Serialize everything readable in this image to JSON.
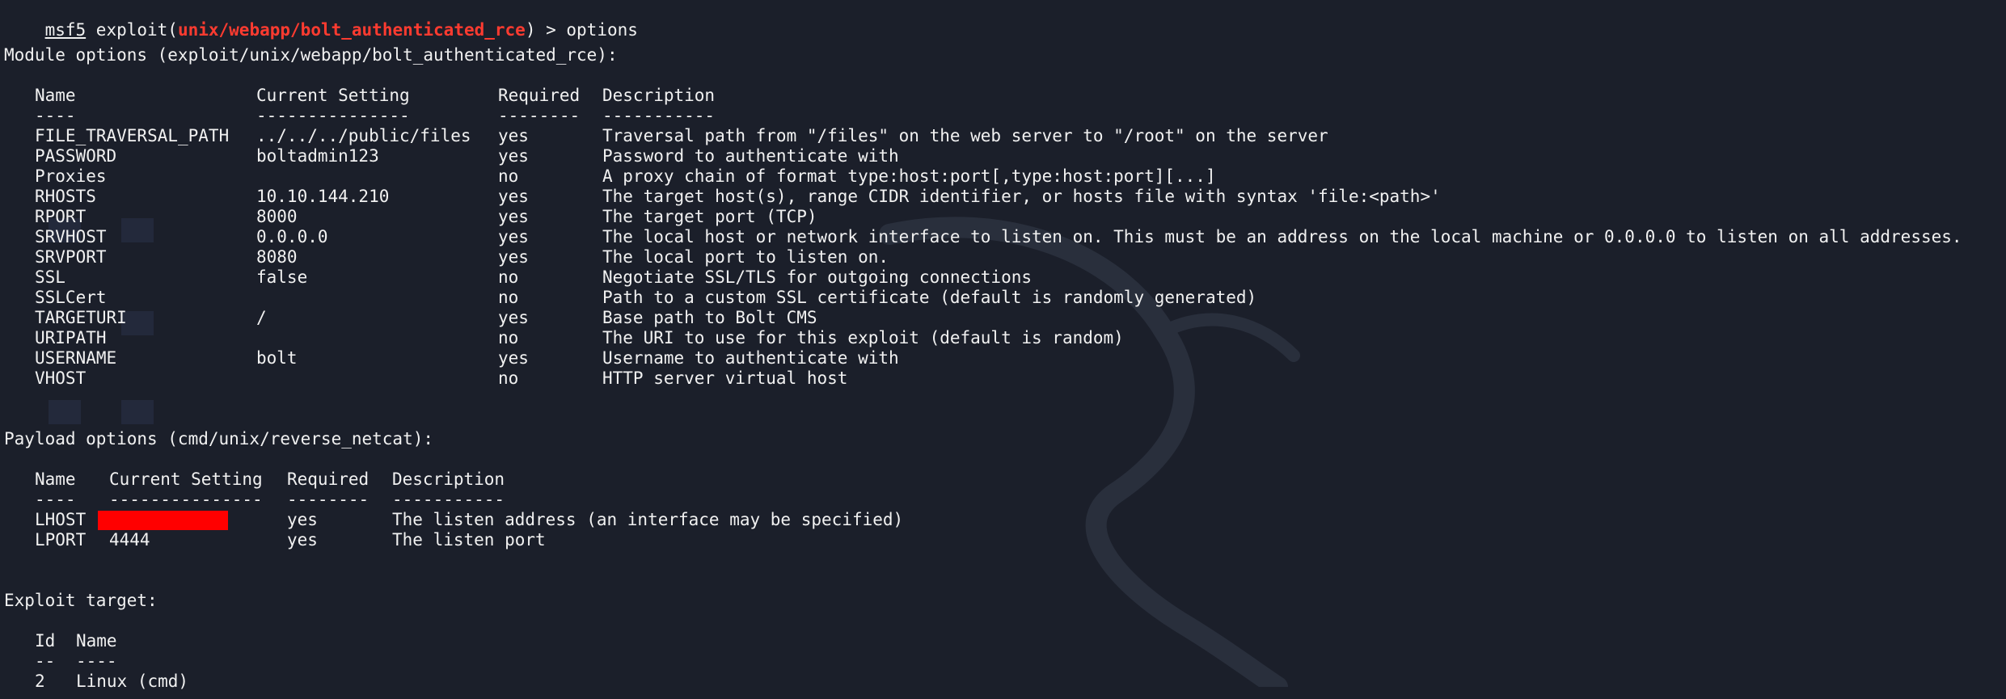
{
  "prompt": {
    "msf": "msf5",
    "exploit_prefix": " exploit(",
    "module_path": "unix/webapp/bolt_authenticated_rce",
    "suffix_and_command": ") > options"
  },
  "module": {
    "header": "Module options (exploit/unix/webapp/bolt_authenticated_rce):",
    "columns": [
      "Name",
      "Current Setting",
      "Required",
      "Description"
    ],
    "separators": [
      "----",
      "---------------",
      "--------",
      "-----------"
    ],
    "rows": [
      {
        "name": "FILE_TRAVERSAL_PATH",
        "setting": "../../../public/files",
        "required": "yes",
        "description": "Traversal path from \"/files\" on the web server to \"/root\" on the server"
      },
      {
        "name": "PASSWORD",
        "setting": "boltadmin123",
        "required": "yes",
        "description": "Password to authenticate with"
      },
      {
        "name": "Proxies",
        "setting": "",
        "required": "no",
        "description": "A proxy chain of format type:host:port[,type:host:port][...]"
      },
      {
        "name": "RHOSTS",
        "setting": "10.10.144.210",
        "required": "yes",
        "description": "The target host(s), range CIDR identifier, or hosts file with syntax 'file:<path>'"
      },
      {
        "name": "RPORT",
        "setting": "8000",
        "required": "yes",
        "description": "The target port (TCP)"
      },
      {
        "name": "SRVHOST",
        "setting": "0.0.0.0",
        "required": "yes",
        "description": "The local host or network interface to listen on. This must be an address on the local machine or 0.0.0.0 to listen on all addresses."
      },
      {
        "name": "SRVPORT",
        "setting": "8080",
        "required": "yes",
        "description": "The local port to listen on."
      },
      {
        "name": "SSL",
        "setting": "false",
        "required": "no",
        "description": "Negotiate SSL/TLS for outgoing connections"
      },
      {
        "name": "SSLCert",
        "setting": "",
        "required": "no",
        "description": "Path to a custom SSL certificate (default is randomly generated)"
      },
      {
        "name": "TARGETURI",
        "setting": "/",
        "required": "yes",
        "description": "Base path to Bolt CMS"
      },
      {
        "name": "URIPATH",
        "setting": "",
        "required": "no",
        "description": "The URI to use for this exploit (default is random)"
      },
      {
        "name": "USERNAME",
        "setting": "bolt",
        "required": "yes",
        "description": "Username to authenticate with"
      },
      {
        "name": "VHOST",
        "setting": "",
        "required": "no",
        "description": "HTTP server virtual host"
      }
    ]
  },
  "payload": {
    "header": "Payload options (cmd/unix/reverse_netcat):",
    "columns": [
      "Name",
      "Current Setting",
      "Required",
      "Description"
    ],
    "separators": [
      "----",
      "---------------",
      "--------",
      "-----------"
    ],
    "rows": [
      {
        "name": "LHOST",
        "setting": "",
        "redacted": true,
        "required": "yes",
        "description": "The listen address (an interface may be specified)"
      },
      {
        "name": "LPORT",
        "setting": "4444",
        "required": "yes",
        "description": "The listen port"
      }
    ]
  },
  "target": {
    "header": "Exploit target:",
    "columns": [
      "Id",
      "Name"
    ],
    "separators": [
      "--",
      "----"
    ],
    "rows": [
      {
        "id": "2",
        "name": "Linux (cmd)"
      }
    ]
  },
  "colors": {
    "background": "#1b1f2a",
    "text": "#f1f1f1",
    "module_path": "#ff3b30",
    "redaction": "#ff0000"
  }
}
